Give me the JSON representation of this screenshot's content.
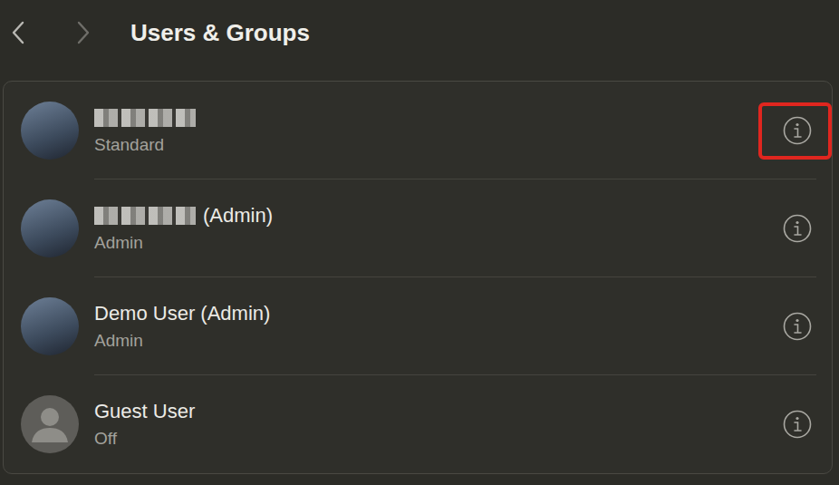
{
  "window": {
    "title": "Users & Groups"
  },
  "nav": {
    "back": {
      "enabled": true
    },
    "forward": {
      "enabled": false
    }
  },
  "users": [
    {
      "name": "",
      "redacted": true,
      "role": "Standard",
      "avatar": "photo",
      "highlighted": true
    },
    {
      "name": "(Admin)",
      "redacted": true,
      "role": "Admin",
      "avatar": "photo",
      "highlighted": false
    },
    {
      "name": "Demo User (Admin)",
      "redacted": false,
      "role": "Admin",
      "avatar": "photo",
      "highlighted": false
    },
    {
      "name": "Guest User",
      "redacted": false,
      "role": "Off",
      "avatar": "silhouette",
      "highlighted": false
    }
  ]
}
